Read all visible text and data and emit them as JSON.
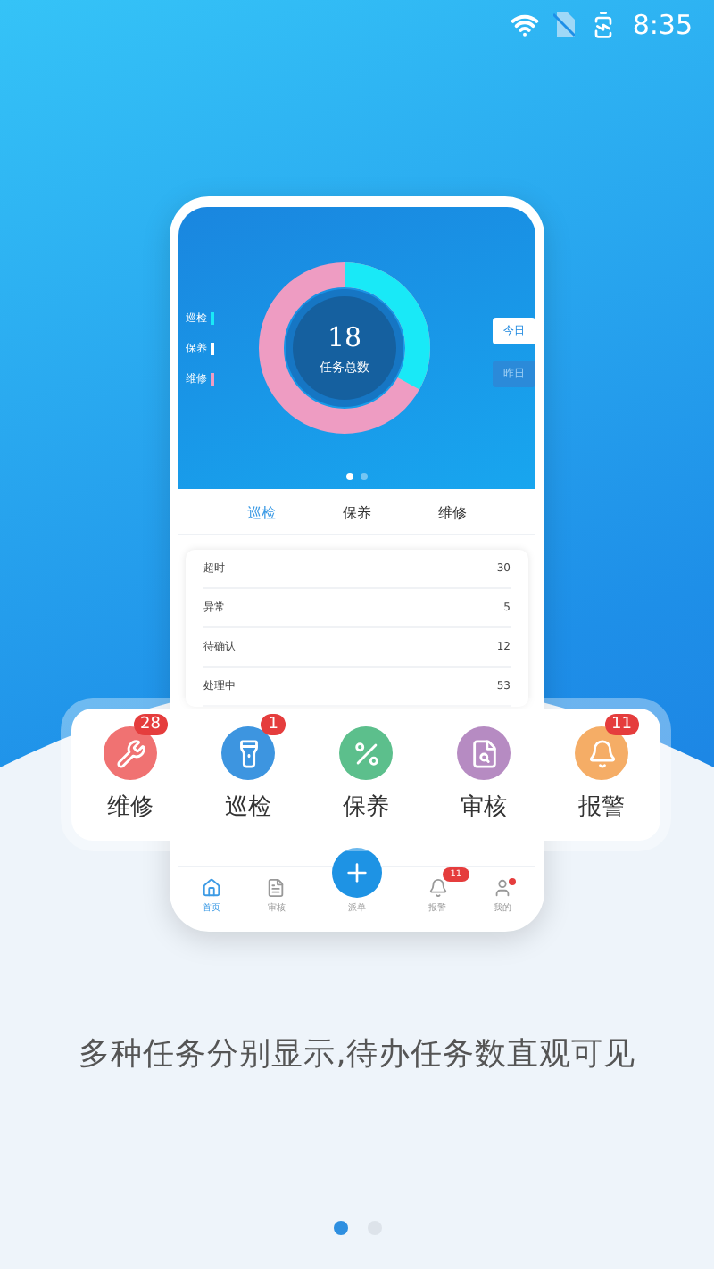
{
  "status_bar": {
    "time": "8:35"
  },
  "phone": {
    "chart": {
      "total": "18",
      "total_label": "任务总数",
      "legend": [
        {
          "label": "巡检",
          "color": "#19e9f7"
        },
        {
          "label": "保养",
          "color": "#ffffff"
        },
        {
          "label": "维修",
          "color": "#ee9cc2"
        }
      ],
      "day_tabs": [
        {
          "label": "今日",
          "selected": true
        },
        {
          "label": "昨日",
          "selected": false
        }
      ],
      "pager": [
        {
          "selected": true
        },
        {
          "selected": false
        }
      ]
    },
    "tabs": [
      {
        "label": "巡检",
        "selected": true
      },
      {
        "label": "保养",
        "selected": false
      },
      {
        "label": "维修",
        "selected": false
      }
    ],
    "rows": [
      {
        "label": "超时",
        "value": "30"
      },
      {
        "label": "异常",
        "value": "5"
      },
      {
        "label": "待确认",
        "value": "12"
      },
      {
        "label": "处理中",
        "value": "53"
      }
    ],
    "nav": [
      {
        "kind": "home",
        "label": "首页",
        "selected": true
      },
      {
        "kind": "review",
        "label": "审核",
        "selected": false
      },
      {
        "kind": "fab",
        "label": "派单",
        "selected": false
      },
      {
        "kind": "alarm",
        "label": "报警",
        "selected": false,
        "badge": "11"
      },
      {
        "kind": "user",
        "label": "我的",
        "selected": false,
        "dot": true
      }
    ]
  },
  "quick_actions": [
    {
      "kind": "repair",
      "label": "维修",
      "color": "#f07272",
      "badge": "28"
    },
    {
      "kind": "patrol",
      "label": "巡检",
      "color": "#3d95e0",
      "badge": "1"
    },
    {
      "kind": "maintain",
      "label": "保养",
      "color": "#5cbf8c"
    },
    {
      "kind": "review",
      "label": "审核",
      "color": "#b68bc2"
    },
    {
      "kind": "alarm",
      "label": "报警",
      "color": "#f5ad66",
      "badge": "11"
    }
  ],
  "caption": "多种任务分别显示,待办任务数直观可见",
  "pager": [
    {
      "selected": true
    },
    {
      "selected": false
    }
  ]
}
